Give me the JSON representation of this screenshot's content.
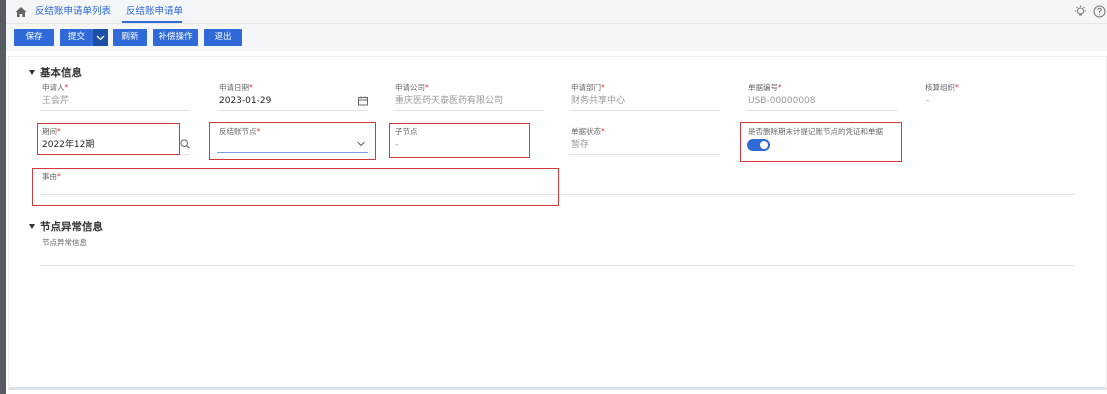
{
  "tabs": [
    {
      "label": "反结账申请单列表"
    },
    {
      "label": "反结账申请单"
    }
  ],
  "toolbar": {
    "save": "保存",
    "submit": "提交",
    "refresh": "刷新",
    "compensate": "补偿操作",
    "exit": "退出"
  },
  "basic": {
    "title": "基本信息",
    "applicant": {
      "label": "申请人",
      "value": "王会芹"
    },
    "apply_date": {
      "label": "申请日期",
      "value": "2023-01-29"
    },
    "company": {
      "label": "申请公司",
      "value": "重庆医药天泰医药有限公司"
    },
    "department": {
      "label": "申请部门",
      "value": "财务共享中心"
    },
    "bill_no": {
      "label": "单据编号",
      "value": "USB-00000008"
    },
    "accounting_org": {
      "label": "核算组织",
      "value": "-"
    },
    "period": {
      "label": "期间",
      "value": "2022年12期"
    },
    "node": {
      "label": "反结账节点",
      "value": ""
    },
    "sub_node": {
      "label": "子节点",
      "value": "-"
    },
    "bill_status": {
      "label": "单据状态",
      "value": "暂存"
    },
    "delete_unposted": {
      "label": "是否删除期末计提记账节点的凭证和单据",
      "on": true
    },
    "reason": {
      "label": "事由",
      "value": ""
    }
  },
  "node_exception": {
    "title": "节点异常信息",
    "field": {
      "label": "节点异常信息",
      "value": ""
    }
  },
  "required_mark": "*",
  "colors": {
    "primary": "#2f6ad8",
    "highlight": "#d23a3a"
  }
}
